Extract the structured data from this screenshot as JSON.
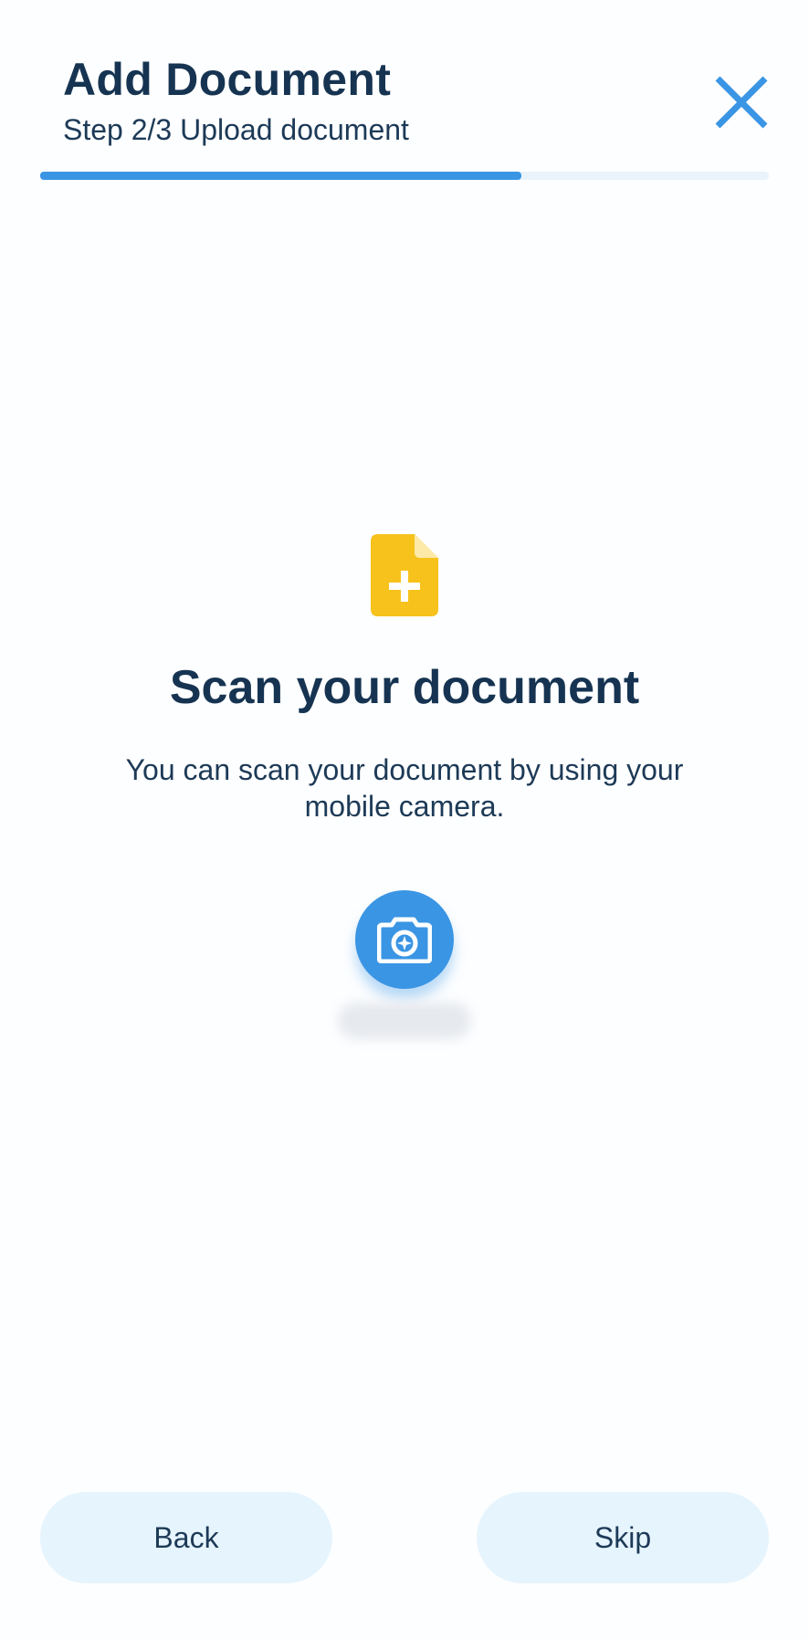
{
  "header": {
    "title": "Add Document",
    "subtitle": "Step 2/3 Upload document",
    "close_icon": "close-icon"
  },
  "progress": {
    "current_step": 2,
    "total_steps": 3,
    "fraction": 0.66,
    "fill_color": "#3a95e4",
    "track_color": "#e8f3fb"
  },
  "main": {
    "icon": "document-add-icon",
    "icon_color": "#f6c21b",
    "title": "Scan your document",
    "description": "You can scan your document by using your mobile camera.",
    "camera_icon": "camera-icon",
    "camera_button_color": "#3a95e4"
  },
  "footer": {
    "back_label": "Back",
    "skip_label": "Skip"
  },
  "colors": {
    "heading": "#163452",
    "accent": "#3a95e4",
    "button_bg": "#e6f4fd"
  }
}
